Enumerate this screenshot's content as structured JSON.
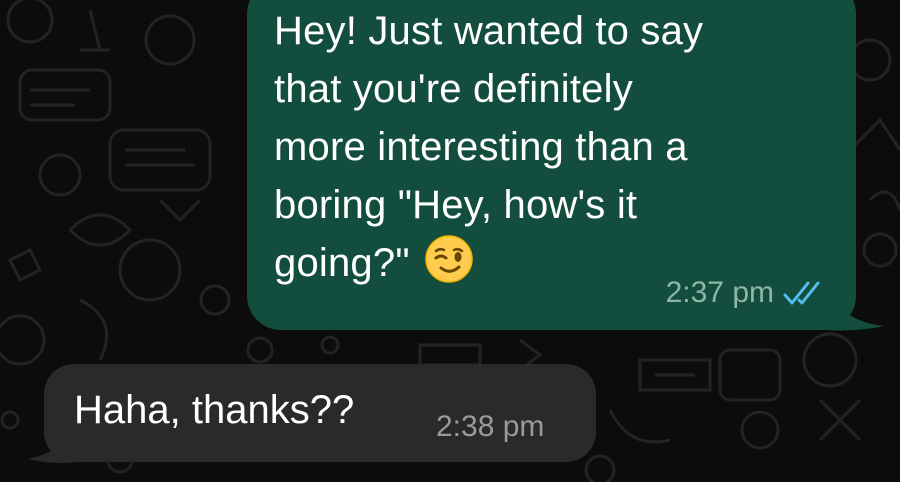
{
  "messages": {
    "outgoing": {
      "lines": [
        "Hey! Just wanted to say",
        "that you're definitely",
        "more interesting than a",
        "boring \"Hey, how's it",
        "going?\""
      ],
      "emoji": "winking-face-emoji",
      "time": "2:37 pm",
      "status": "read-double-tick-icon"
    },
    "incoming": {
      "text": "Haha, thanks??",
      "time": "2:38 pm"
    }
  },
  "colors": {
    "background": "#0c0c0c",
    "outgoing_bubble": "#134d3e",
    "incoming_bubble": "#2a2a2a",
    "read_tick": "#53bdeb"
  }
}
